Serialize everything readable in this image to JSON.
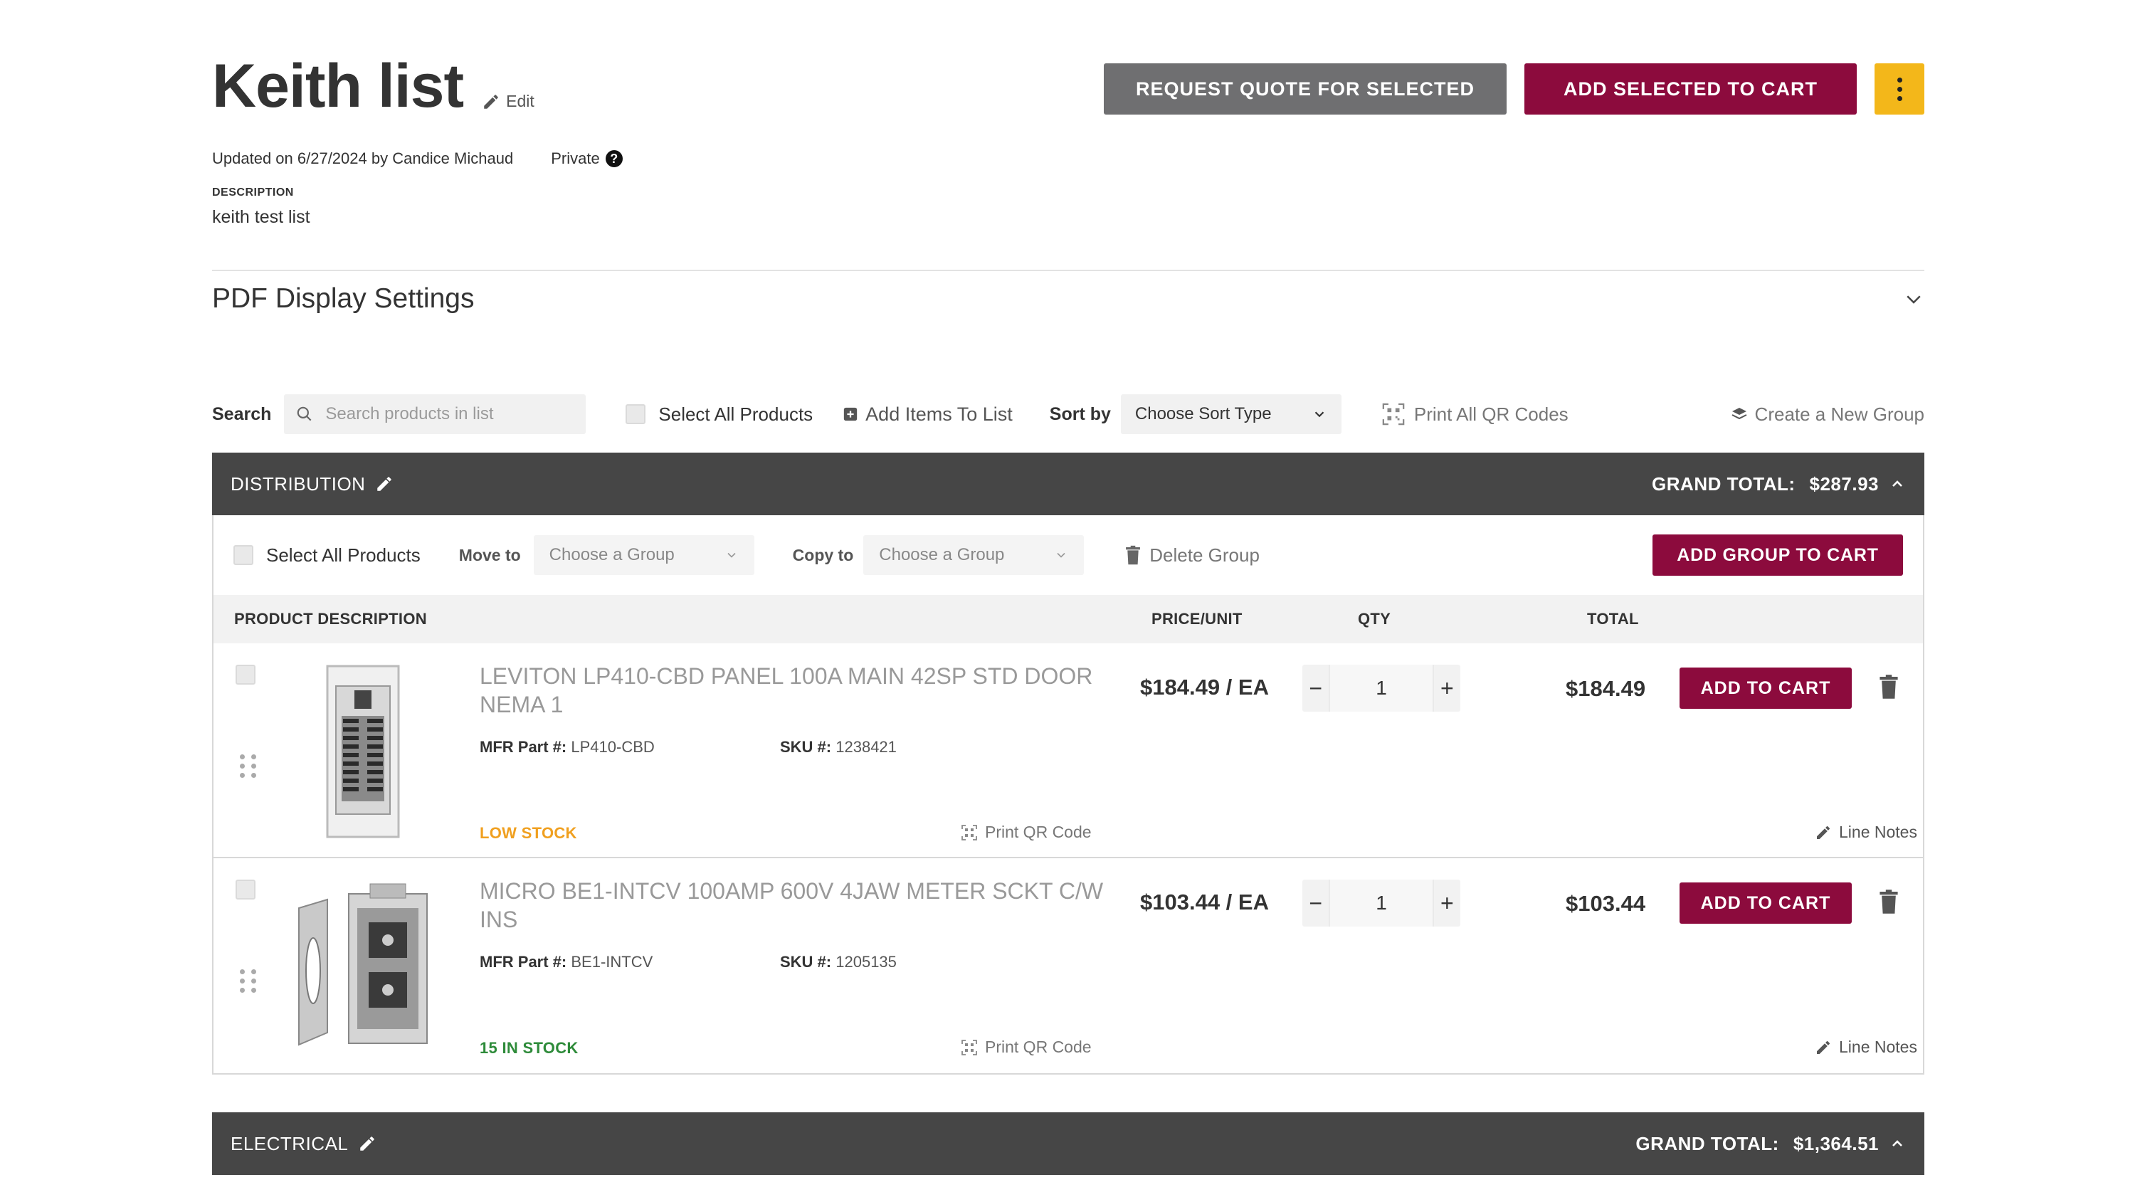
{
  "header": {
    "title": "Keith list",
    "edit_label": "Edit",
    "updated": "Updated on 6/27/2024 by Candice Michaud",
    "privacy": "Private",
    "description_label": "DESCRIPTION",
    "description": "keith test list",
    "request_quote_label": "REQUEST QUOTE FOR SELECTED",
    "add_selected_label": "ADD SELECTED TO CART"
  },
  "pdf_settings": {
    "title": "PDF Display Settings"
  },
  "toolbar": {
    "search_label": "Search",
    "search_placeholder": "Search products in list",
    "select_all_label": "Select All Products",
    "add_items_label": "Add Items To List",
    "sort_label": "Sort by",
    "sort_value": "Choose Sort Type",
    "print_all_label": "Print All QR Codes",
    "create_group_label": "Create a New Group"
  },
  "groups": [
    {
      "name": "DISTRIBUTION",
      "grand_total_label": "GRAND TOTAL:",
      "grand_total": "$287.93",
      "select_all_label": "Select All Products",
      "move_to_label": "Move to",
      "move_to_placeholder": "Choose a Group",
      "copy_to_label": "Copy to",
      "copy_to_placeholder": "Choose a Group",
      "delete_label": "Delete Group",
      "add_group_label": "ADD GROUP TO CART",
      "columns": {
        "description": "PRODUCT DESCRIPTION",
        "price": "PRICE/UNIT",
        "qty": "QTY",
        "total": "TOTAL"
      },
      "items": [
        {
          "name": "LEVITON LP410-CBD PANEL 100A MAIN 42SP STD DOOR NEMA 1",
          "mfr_label": "MFR Part #:",
          "mfr": "LP410-CBD",
          "sku_label": "SKU #:",
          "sku": "1238421",
          "stock": "LOW STOCK",
          "price": "$184.49 / EA",
          "qty": "1",
          "total": "$184.49",
          "add_label": "ADD TO CART",
          "print_qr_label": "Print QR Code",
          "line_notes_label": "Line Notes"
        },
        {
          "name": "MICRO BE1-INTCV 100AMP 600V 4JAW METER SCKT C/W INS",
          "mfr_label": "MFR Part #:",
          "mfr": "BE1-INTCV",
          "sku_label": "SKU #:",
          "sku": "1205135",
          "stock": "15 IN STOCK",
          "price": "$103.44 / EA",
          "qty": "1",
          "total": "$103.44",
          "add_label": "ADD TO CART",
          "print_qr_label": "Print QR Code",
          "line_notes_label": "Line Notes"
        }
      ]
    },
    {
      "name": "ELECTRICAL",
      "grand_total_label": "GRAND TOTAL:",
      "grand_total": "$1,364.51"
    }
  ],
  "colors": {
    "brand": "#8c0b3d",
    "accent": "#f3b71a",
    "header_bar": "#464646",
    "low_stock": "#f0a020",
    "in_stock": "#2e8b3a"
  }
}
